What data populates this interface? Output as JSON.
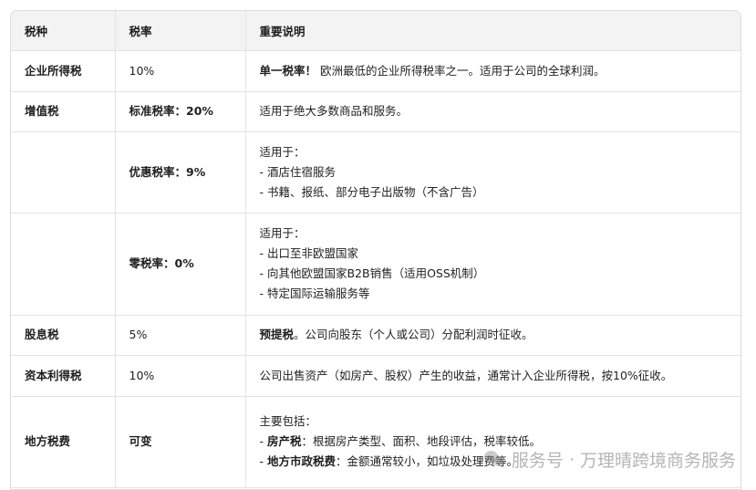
{
  "headers": [
    "税种",
    "税率",
    "重要说明"
  ],
  "rows": {
    "r1": {
      "name": "企业所得税",
      "rate": "10%",
      "bold": "单一税率！",
      "text": " 欧洲最低的企业所得税率之一。适用于公司的全球利润。"
    },
    "r2": {
      "name": "增值税",
      "rate": "标准税率：20%",
      "text": "适用于绝大多数商品和服务。"
    },
    "r3": {
      "name": "",
      "rate": "优惠税率：9%",
      "lines": [
        "适用于：",
        "- 酒店住宿服务",
        "- 书籍、报纸、部分电子出版物（不含广告）"
      ]
    },
    "r4": {
      "name": "",
      "rate": "零税率：0%",
      "lines": [
        "适用于：",
        "- 出口至非欧盟国家",
        "- 向其他欧盟国家B2B销售（适用OSS机制）",
        "- 特定国际运输服务等"
      ]
    },
    "r5": {
      "name": "股息税",
      "rate": "5%",
      "bold": "预提税",
      "text": "。公司向股东（个人或公司）分配利润时征收。"
    },
    "r6": {
      "name": "资本利得税",
      "rate": "10%",
      "text": "公司出售资产（如房产、股权）产生的收益，通常计入企业所得税，按10%征收。"
    },
    "r7": {
      "name": "地方税费",
      "rate": "可变",
      "intro": "主要包括：",
      "item1_prefix": "- ",
      "item1_bold": "房产税",
      "item1_text": "：根据房产类型、面积、地段评估，税率较低。",
      "item2_prefix": "- ",
      "item2_bold": "地方市政税费",
      "item2_text": "：金额通常较小，如垃圾处理费等。"
    }
  },
  "watermark": {
    "left": "服务号",
    "sep": "·",
    "right": "万理晴跨境商务服务"
  }
}
